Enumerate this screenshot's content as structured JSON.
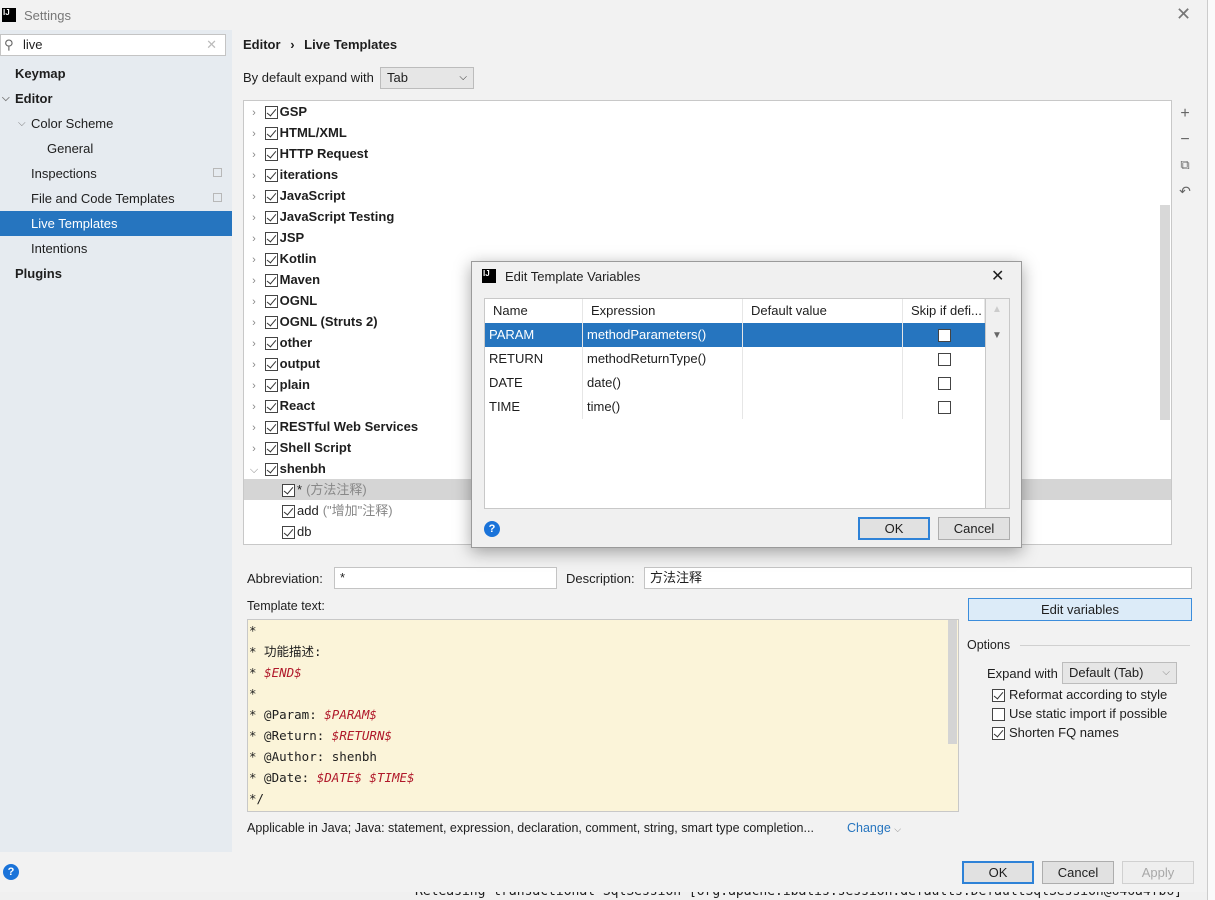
{
  "window": {
    "title": "Settings",
    "close_icon": "close-icon"
  },
  "search": {
    "value": "live"
  },
  "sidebar": {
    "items": [
      {
        "label": "Keymap",
        "bold": true,
        "indent": 15
      },
      {
        "label": "Editor",
        "bold": true,
        "indent": 15,
        "expanded": true
      },
      {
        "label": "Color Scheme",
        "indent": 31,
        "expanded": true
      },
      {
        "label": "General",
        "indent": 47
      },
      {
        "label": "Inspections",
        "indent": 31,
        "copy": true
      },
      {
        "label": "File and Code Templates",
        "indent": 31,
        "copy": true
      },
      {
        "label": "Live Templates",
        "indent": 31,
        "selected": true
      },
      {
        "label": "Intentions",
        "indent": 31
      },
      {
        "label": "Plugins",
        "bold": true,
        "indent": 15
      }
    ]
  },
  "breadcrumb": {
    "parent": "Editor",
    "sep": "›",
    "current": "Live Templates"
  },
  "expand_default": {
    "label": "By default expand with",
    "value": "Tab"
  },
  "tree": {
    "items": [
      {
        "name": "GSP",
        "group": true,
        "checked": true
      },
      {
        "name": "HTML/XML",
        "group": true,
        "checked": true
      },
      {
        "name": "HTTP Request",
        "group": true,
        "checked": true
      },
      {
        "name": "iterations",
        "group": true,
        "checked": true
      },
      {
        "name": "JavaScript",
        "group": true,
        "checked": true
      },
      {
        "name": "JavaScript Testing",
        "group": true,
        "checked": true
      },
      {
        "name": "JSP",
        "group": true,
        "checked": true
      },
      {
        "name": "Kotlin",
        "group": true,
        "checked": true
      },
      {
        "name": "Maven",
        "group": true,
        "checked": true
      },
      {
        "name": "OGNL",
        "group": true,
        "checked": true
      },
      {
        "name": "OGNL (Struts 2)",
        "group": true,
        "checked": true
      },
      {
        "name": "other",
        "group": true,
        "checked": true
      },
      {
        "name": "output",
        "group": true,
        "checked": true
      },
      {
        "name": "plain",
        "group": true,
        "checked": true
      },
      {
        "name": "React",
        "group": true,
        "checked": true
      },
      {
        "name": "RESTful Web Services",
        "group": true,
        "checked": true
      },
      {
        "name": "Shell Script",
        "group": true,
        "checked": true
      },
      {
        "name": "shenbh",
        "group": true,
        "checked": true,
        "expanded": true
      },
      {
        "name": "*",
        "desc": "(方法注释)",
        "checked": true,
        "selected": true
      },
      {
        "name": "add",
        "desc": "(\"增加\"注释)",
        "checked": true
      },
      {
        "name": "db",
        "checked": true
      }
    ]
  },
  "toolbar": {
    "add": "+",
    "remove": "−",
    "copy": "⧉",
    "revert": "↶"
  },
  "abbreviation": {
    "label": "Abbreviation:",
    "value": "*"
  },
  "description": {
    "label": "Description:",
    "value": "方法注释"
  },
  "template_text": {
    "label": "Template text:",
    "lines": [
      [
        {
          "t": "*"
        }
      ],
      [
        {
          "t": "* 功能描述:"
        }
      ],
      [
        {
          "t": "* "
        },
        {
          "t": "$END$",
          "var": true
        }
      ],
      [
        {
          "t": "*"
        }
      ],
      [
        {
          "t": "* @Param: "
        },
        {
          "t": "$PARAM$",
          "var": true
        }
      ],
      [
        {
          "t": "* @Return: "
        },
        {
          "t": "$RETURN$",
          "var": true
        }
      ],
      [
        {
          "t": "* @Author: shenbh"
        }
      ],
      [
        {
          "t": "* @Date: "
        },
        {
          "t": "$DATE$",
          "var": true
        },
        {
          "t": " "
        },
        {
          "t": "$TIME$",
          "var": true
        }
      ],
      [
        {
          "t": "*/"
        }
      ]
    ]
  },
  "edit_variables": "Edit variables",
  "options": {
    "title": "Options",
    "expand_with_label": "Expand with",
    "expand_with_value": "Default (Tab)",
    "checks": [
      {
        "label": "Reformat according to style",
        "checked": true
      },
      {
        "label": "Use static import if possible",
        "checked": false
      },
      {
        "label": "Shorten FQ names",
        "checked": true
      }
    ]
  },
  "applicable": {
    "text": "Applicable in Java; Java: statement, expression, declaration, comment, string, smart type completion...",
    "change": "Change"
  },
  "footer": {
    "ok": "OK",
    "cancel": "Cancel",
    "apply": "Apply"
  },
  "background_console": "Releasing transactional SqlSession [org.apache.ibatis.session.defaults.DefaultSqlSession@646a4fb6]",
  "dialog": {
    "title": "Edit Template Variables",
    "columns": [
      "Name",
      "Expression",
      "Default value",
      "Skip if defi..."
    ],
    "rows": [
      {
        "name": "PARAM",
        "expression": "methodParameters()",
        "default": "",
        "skip": false,
        "selected": true
      },
      {
        "name": "RETURN",
        "expression": "methodReturnType()",
        "default": "",
        "skip": false
      },
      {
        "name": "DATE",
        "expression": "date()",
        "default": "",
        "skip": false
      },
      {
        "name": "TIME",
        "expression": "time()",
        "default": "",
        "skip": false
      }
    ],
    "ok": "OK",
    "cancel": "Cancel",
    "up": "▲",
    "down": "▼"
  },
  "colors": {
    "selection": "#2675bf",
    "template_bg": "#fbf4d9",
    "variable": "#b0182a",
    "link": "#2675bf"
  }
}
